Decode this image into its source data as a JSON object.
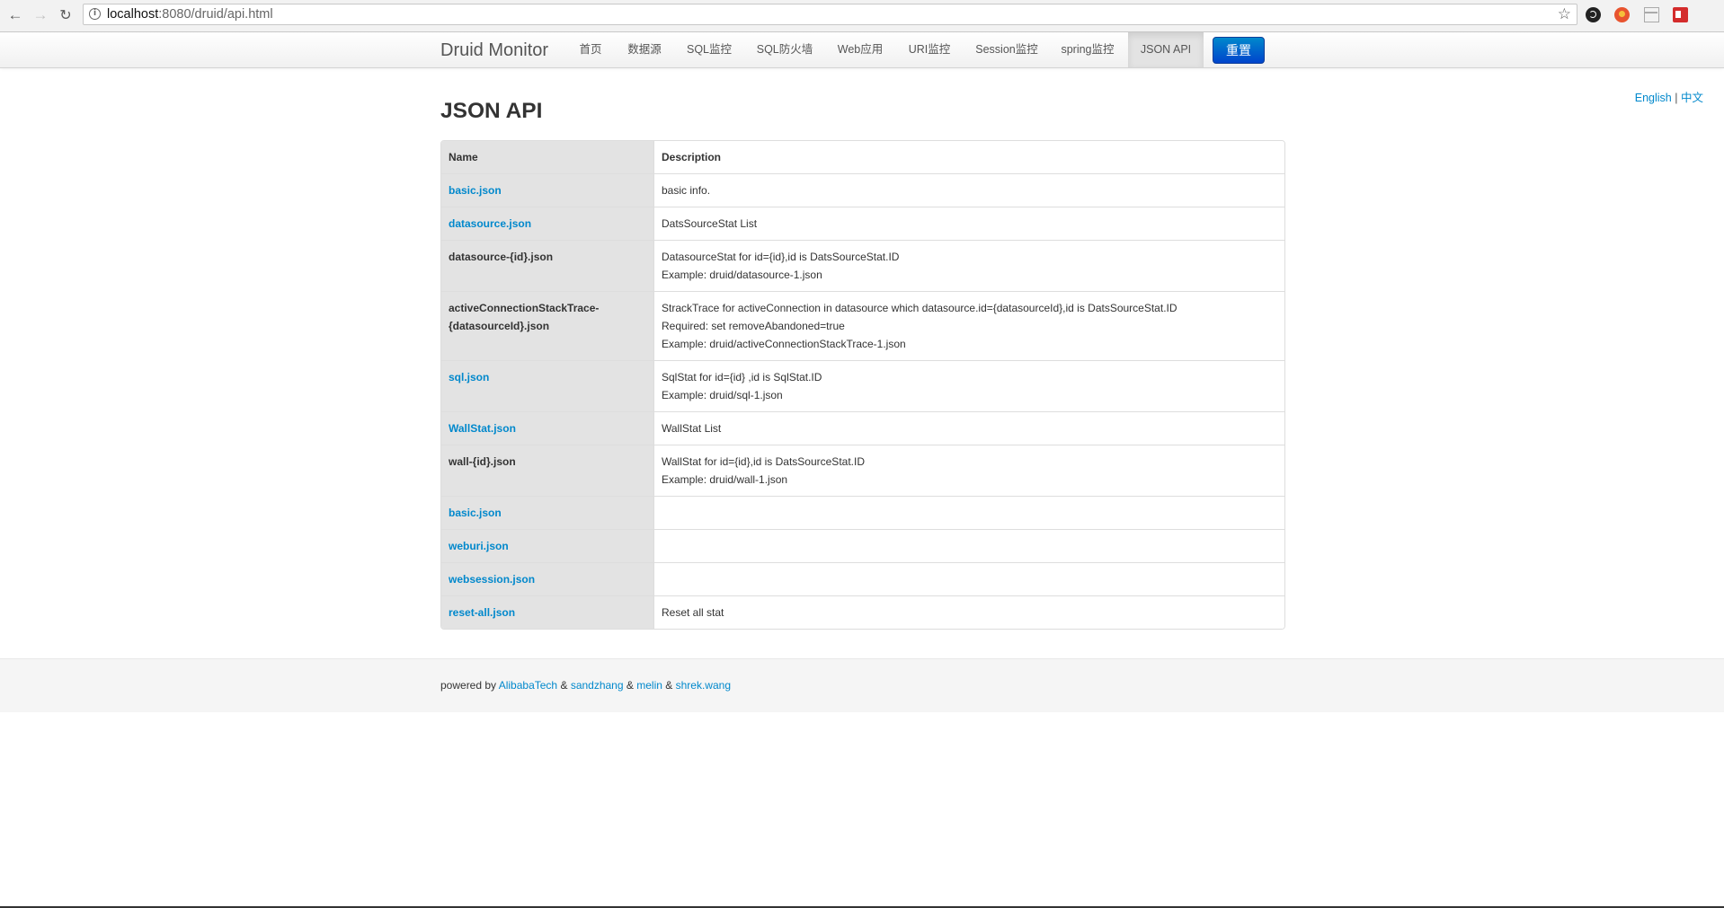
{
  "browser": {
    "url_host": "localhost",
    "url_rest": ":8080/druid/api.html"
  },
  "navbar": {
    "brand": "Druid Monitor",
    "items": [
      "首页",
      "数据源",
      "SQL监控",
      "SQL防火墙",
      "Web应用",
      "URI监控",
      "Session监控",
      "spring监控",
      "JSON API"
    ],
    "active": "JSON API",
    "reset_label": "重置"
  },
  "lang": {
    "english": "English",
    "separator": "|",
    "chinese": "中文"
  },
  "page": {
    "title": "JSON API"
  },
  "table": {
    "headers": {
      "name": "Name",
      "description": "Description"
    },
    "rows": [
      {
        "name": "basic.json",
        "link": true,
        "desc": [
          "basic info."
        ]
      },
      {
        "name": "datasource.json",
        "link": true,
        "desc": [
          "DatsSourceStat List"
        ]
      },
      {
        "name": "datasource-{id}.json",
        "link": false,
        "desc": [
          "DatasourceStat for id={id},id is DatsSourceStat.ID",
          "Example: druid/datasource-1.json"
        ]
      },
      {
        "name": "activeConnectionStackTrace-{datasourceId}.json",
        "name_lines": [
          "activeConnectionStackTrace-",
          "{datasourceId}.json"
        ],
        "link": false,
        "desc": [
          "StrackTrace for activeConnection in datasource which datasource.id={datasourceId},id is DatsSourceStat.ID",
          "Required: set removeAbandoned=true",
          "Example: druid/activeConnectionStackTrace-1.json"
        ]
      },
      {
        "name": "sql.json",
        "link": true,
        "desc": [
          "SqlStat for id={id} ,id is SqlStat.ID",
          "Example: druid/sql-1.json"
        ]
      },
      {
        "name": "WallStat.json",
        "link": true,
        "desc": [
          "WallStat List"
        ]
      },
      {
        "name": "wall-{id}.json",
        "link": false,
        "desc": [
          "WallStat for id={id},id is DatsSourceStat.ID",
          "Example: druid/wall-1.json"
        ]
      },
      {
        "name": "basic.json",
        "link": true,
        "desc": []
      },
      {
        "name": "weburi.json",
        "link": true,
        "desc": []
      },
      {
        "name": "websession.json",
        "link": true,
        "desc": []
      },
      {
        "name": "reset-all.json",
        "link": true,
        "desc": [
          "Reset all stat"
        ]
      }
    ]
  },
  "footer": {
    "powered_by": "powered by",
    "amp": "&",
    "credits": [
      "AlibabaTech",
      "sandzhang",
      "melin",
      "shrek.wang"
    ]
  }
}
